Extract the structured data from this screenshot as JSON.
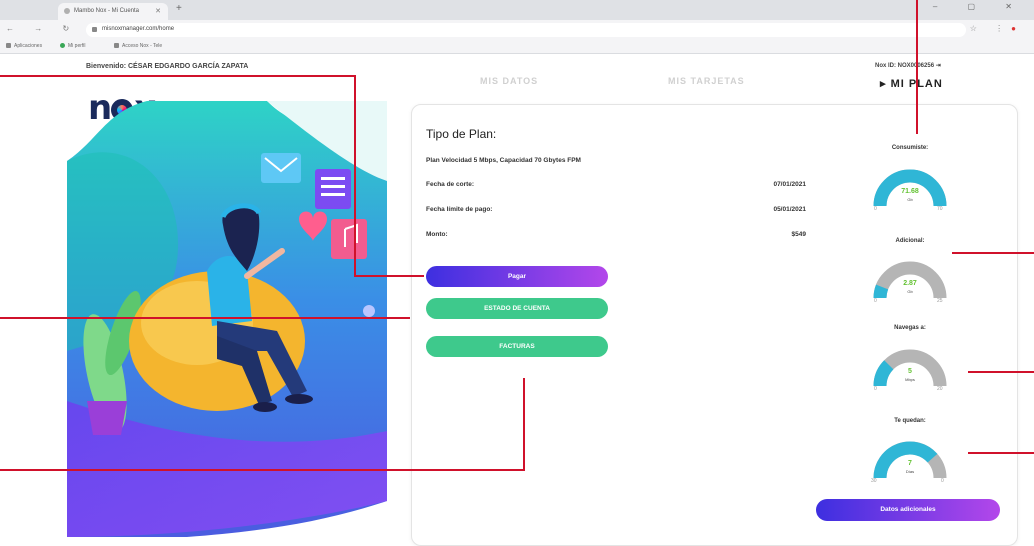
{
  "browser": {
    "tab_title": "Mambo Nox - Mi Cuenta",
    "new_tab": "+",
    "window_controls": "– ▢ ✕",
    "url": "misnoxmanager.com/home",
    "bookmarks": [
      "Aplicaciones",
      "Mi perfil",
      "Acceso Nox - Tele"
    ]
  },
  "header": {
    "welcome": "Bienvenido: CÉSAR EDGARDO GARCÍA ZAPATA",
    "nav": [
      "MIS DATOS",
      "MIS TARJETAS",
      "MI PLAN"
    ],
    "active_marker": "▸",
    "nox_id": "Nox ID: NOX0006256",
    "logout_icon": "⇥"
  },
  "logo": {
    "prefix": "n",
    "suffix": "x"
  },
  "plan": {
    "title": "Tipo de Plan:",
    "description": "Plan Velocidad 5 Mbps, Capacidad 70 Gbytes FPM",
    "rows": [
      {
        "label": "Fecha de corte:",
        "value": "07/01/2021"
      },
      {
        "label": "Fecha límite de pago:",
        "value": "05/01/2021"
      },
      {
        "label": "Monto:",
        "value": "$549"
      }
    ],
    "buttons": {
      "pay": "Pagar",
      "statement": "ESTADO DE CUENTA",
      "invoices": "FACTURAS"
    }
  },
  "gauges": [
    {
      "label": "Consumiste:",
      "value": "71.68",
      "unit": "Gb",
      "min": "0",
      "max": "70",
      "fill": 1.0
    },
    {
      "label": "Adicional:",
      "value": "2.87",
      "unit": "Gb",
      "min": "0",
      "max": "25",
      "fill": 0.12
    },
    {
      "label": "Navegas a:",
      "value": "5",
      "unit": "Mbps",
      "min": "0",
      "max": "20",
      "fill": 0.25
    },
    {
      "label": "Te quedan:",
      "value": "7",
      "unit": "Días",
      "min": "30",
      "max": "0",
      "fill": 0.77
    }
  ],
  "extra_button": "Datos adicionales",
  "colors": {
    "gauge_fill": "#2fb6d6",
    "gauge_track": "#b5b5b5",
    "gauge_value": "#63c232",
    "callout": "#d0112b",
    "button_gradient_start": "#3d2fe0",
    "button_gradient_end": "#b347ea",
    "button_green": "#3ec98c"
  }
}
